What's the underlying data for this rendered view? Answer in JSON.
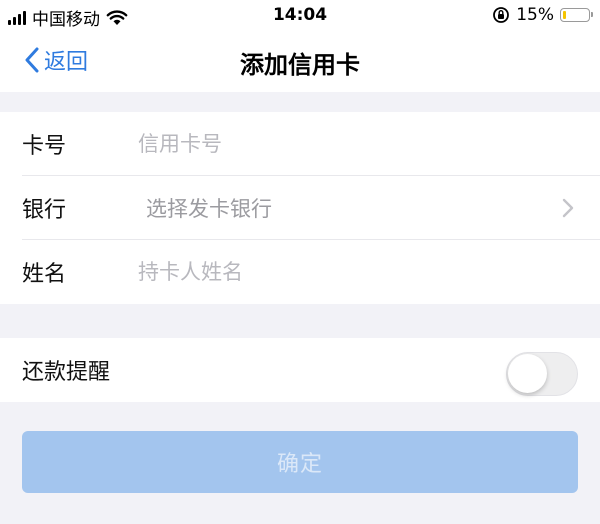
{
  "status_bar": {
    "carrier": "中国移动",
    "time": "14:04",
    "battery_percent": "15%",
    "battery_level": 0.15,
    "battery_color": "#f5c400",
    "icons": [
      "signal-icon",
      "wifi-icon",
      "orientation-lock-icon",
      "battery-icon"
    ]
  },
  "nav": {
    "back_label": "返回",
    "title": "添加信用卡",
    "accent": "#2f7bdf"
  },
  "form": {
    "card_number": {
      "label": "卡号",
      "placeholder": "信用卡号"
    },
    "bank": {
      "label": "银行",
      "placeholder": "选择发卡银行"
    },
    "name": {
      "label": "姓名",
      "placeholder": "持卡人姓名"
    }
  },
  "reminder": {
    "label": "还款提醒",
    "enabled": false
  },
  "confirm": {
    "label": "确定",
    "color": "#a3c5ee"
  }
}
